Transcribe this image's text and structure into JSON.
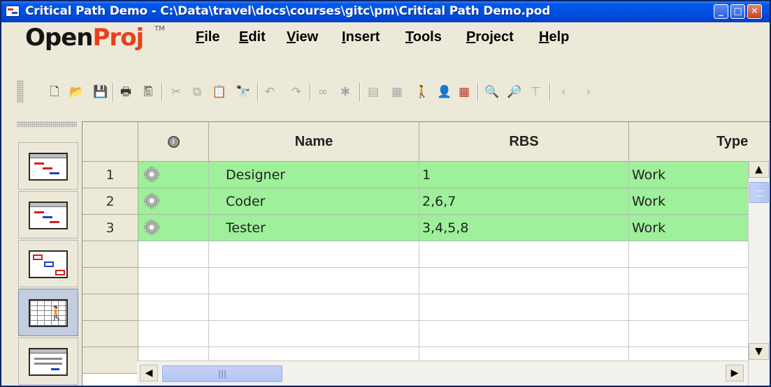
{
  "window": {
    "title": "Critical Path Demo - C:\\Data\\travel\\docs\\courses\\gitc\\pm\\Critical Path Demo.pod",
    "minimize_glyph": "_",
    "maximize_glyph": "□",
    "close_glyph": "✕"
  },
  "logo": {
    "open": "Open",
    "proj": "Proj",
    "tm": "TM"
  },
  "menu": [
    {
      "label": "File",
      "mnemonic": "F",
      "rest": "ile"
    },
    {
      "label": "Edit",
      "mnemonic": "E",
      "rest": "dit"
    },
    {
      "label": "View",
      "mnemonic": "V",
      "rest": "iew"
    },
    {
      "label": "Insert",
      "mnemonic": "I",
      "rest": "nsert"
    },
    {
      "label": "Tools",
      "mnemonic": "T",
      "rest": "ools"
    },
    {
      "label": "Project",
      "mnemonic": "P",
      "rest": "roject"
    },
    {
      "label": "Help",
      "mnemonic": "H",
      "rest": "elp"
    }
  ],
  "toolbar": {
    "icons": [
      "new-document-icon",
      "open-folder-icon",
      "save-icon",
      "print-icon",
      "print-preview-icon",
      "cut-icon",
      "copy-icon",
      "paste-icon",
      "find-icon",
      "undo-icon",
      "redo-icon",
      "link-icon",
      "unlink-icon",
      "task-information-icon",
      "notes-icon",
      "assign-resources-icon",
      "resource-icon",
      "calendar-grid-icon",
      "zoom-in-icon",
      "zoom-out-icon",
      "filter-icon",
      "scroll-left-icon",
      "scroll-right-icon"
    ]
  },
  "views": [
    "gantt-view",
    "tracking-gantt-view",
    "network-diagram-view",
    "resource-sheet-view",
    "resource-usage-view"
  ],
  "views_active": "resource-sheet-view",
  "table": {
    "info_header": "i",
    "headers": {
      "name": "Name",
      "rbs": "RBS",
      "type": "Type"
    },
    "rows": [
      {
        "id": "1",
        "name": "Designer",
        "rbs": "1",
        "type": "Work"
      },
      {
        "id": "2",
        "name": "Coder",
        "rbs": "2,6,7",
        "type": "Work"
      },
      {
        "id": "3",
        "name": "Tester",
        "rbs": "3,4,5,8",
        "type": "Work"
      }
    ],
    "empty_rows": 5
  },
  "scroll": {
    "up": "▲",
    "down": "▼",
    "left": "◀",
    "right": "▶",
    "grip": "|||"
  },
  "colors": {
    "filled_row": "#9ef09a",
    "title_bar": "#0054e3",
    "logo_proj": "#e8401c"
  }
}
